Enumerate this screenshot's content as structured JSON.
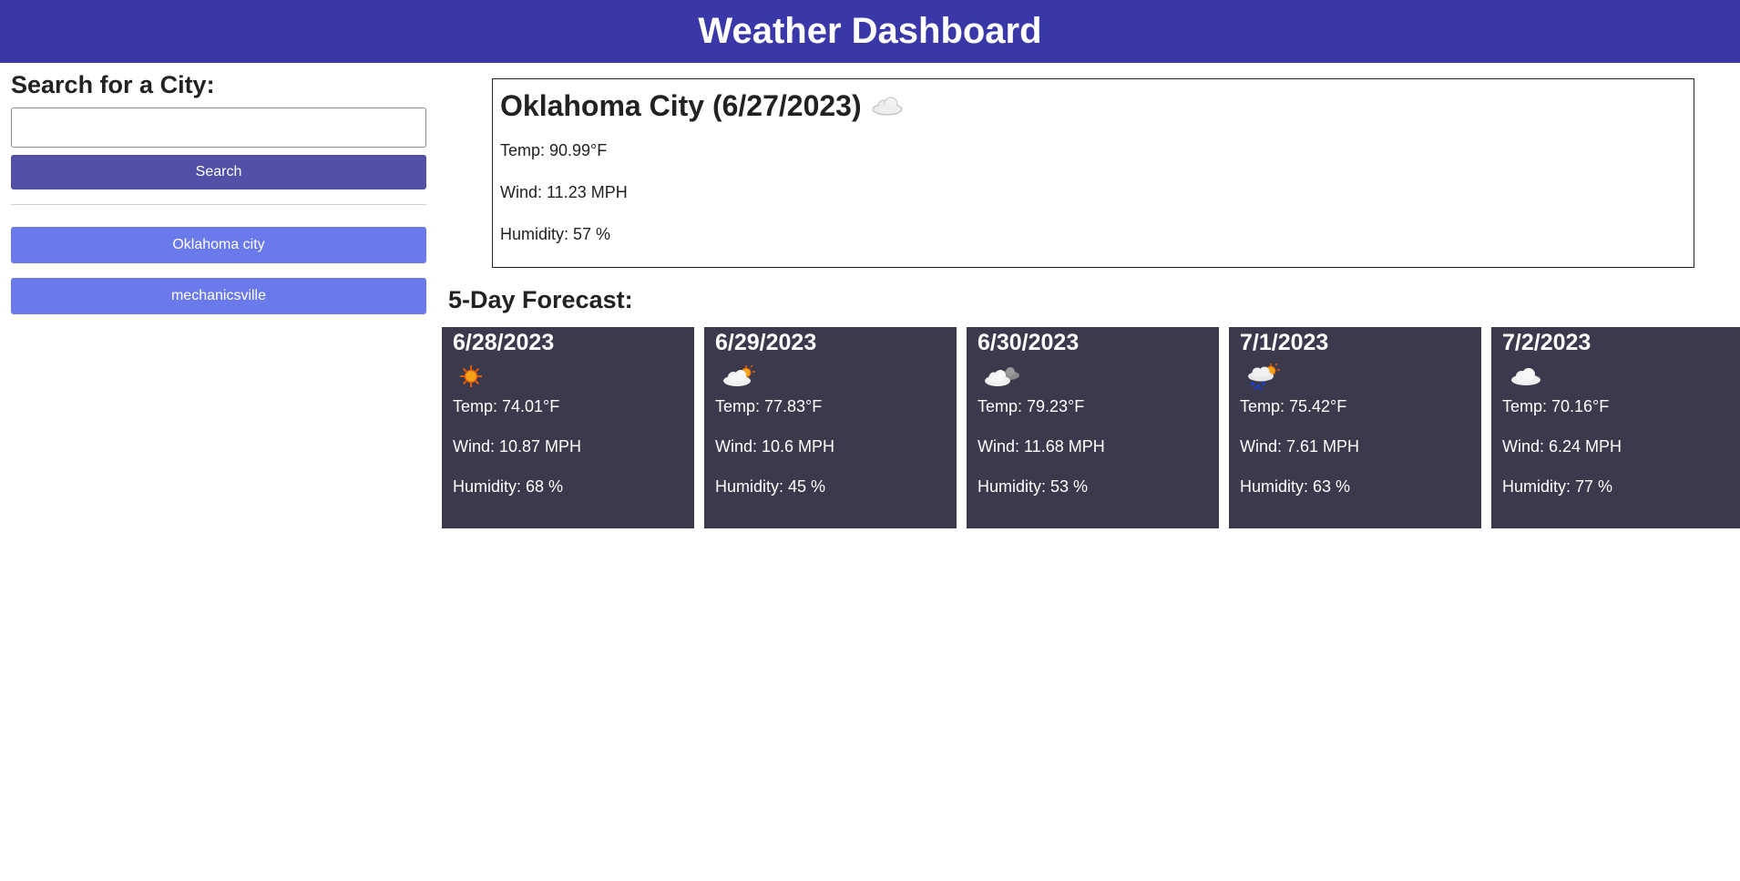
{
  "header": {
    "title": "Weather Dashboard"
  },
  "sidebar": {
    "heading": "Search for a City:",
    "search_input": {
      "value": "",
      "placeholder": ""
    },
    "search_button": "Search",
    "history": [
      {
        "label": "Oklahoma city"
      },
      {
        "label": "mechanicsville"
      }
    ]
  },
  "current": {
    "title": "Oklahoma City (6/27/2023)",
    "icon": "cloud-icon",
    "temp": "Temp: 90.99°F",
    "wind": "Wind: 11.23 MPH",
    "humidity": "Humidity: 57 %"
  },
  "forecast": {
    "title": "5-Day Forecast:",
    "days": [
      {
        "date": "6/28/2023",
        "icon": "sun-icon",
        "temp": "Temp: 74.01°F",
        "wind": "Wind: 10.87 MPH",
        "humidity": "Humidity: 68 %"
      },
      {
        "date": "6/29/2023",
        "icon": "partly-cloudy-icon",
        "temp": "Temp: 77.83°F",
        "wind": "Wind: 10.6 MPH",
        "humidity": "Humidity: 45 %"
      },
      {
        "date": "6/30/2023",
        "icon": "broken-clouds-icon",
        "temp": "Temp: 79.23°F",
        "wind": "Wind: 11.68 MPH",
        "humidity": "Humidity: 53 %"
      },
      {
        "date": "7/1/2023",
        "icon": "rain-sun-icon",
        "temp": "Temp: 75.42°F",
        "wind": "Wind: 7.61 MPH",
        "humidity": "Humidity: 63 %"
      },
      {
        "date": "7/2/2023",
        "icon": "cloud-icon",
        "temp": "Temp: 70.16°F",
        "wind": "Wind: 6.24 MPH",
        "humidity": "Humidity: 77 %"
      }
    ]
  },
  "colors": {
    "header_bg": "#3a37a8",
    "search_button": "#5350a8",
    "history_button": "#6a7aeb",
    "card_bg": "#3a3a4c"
  }
}
